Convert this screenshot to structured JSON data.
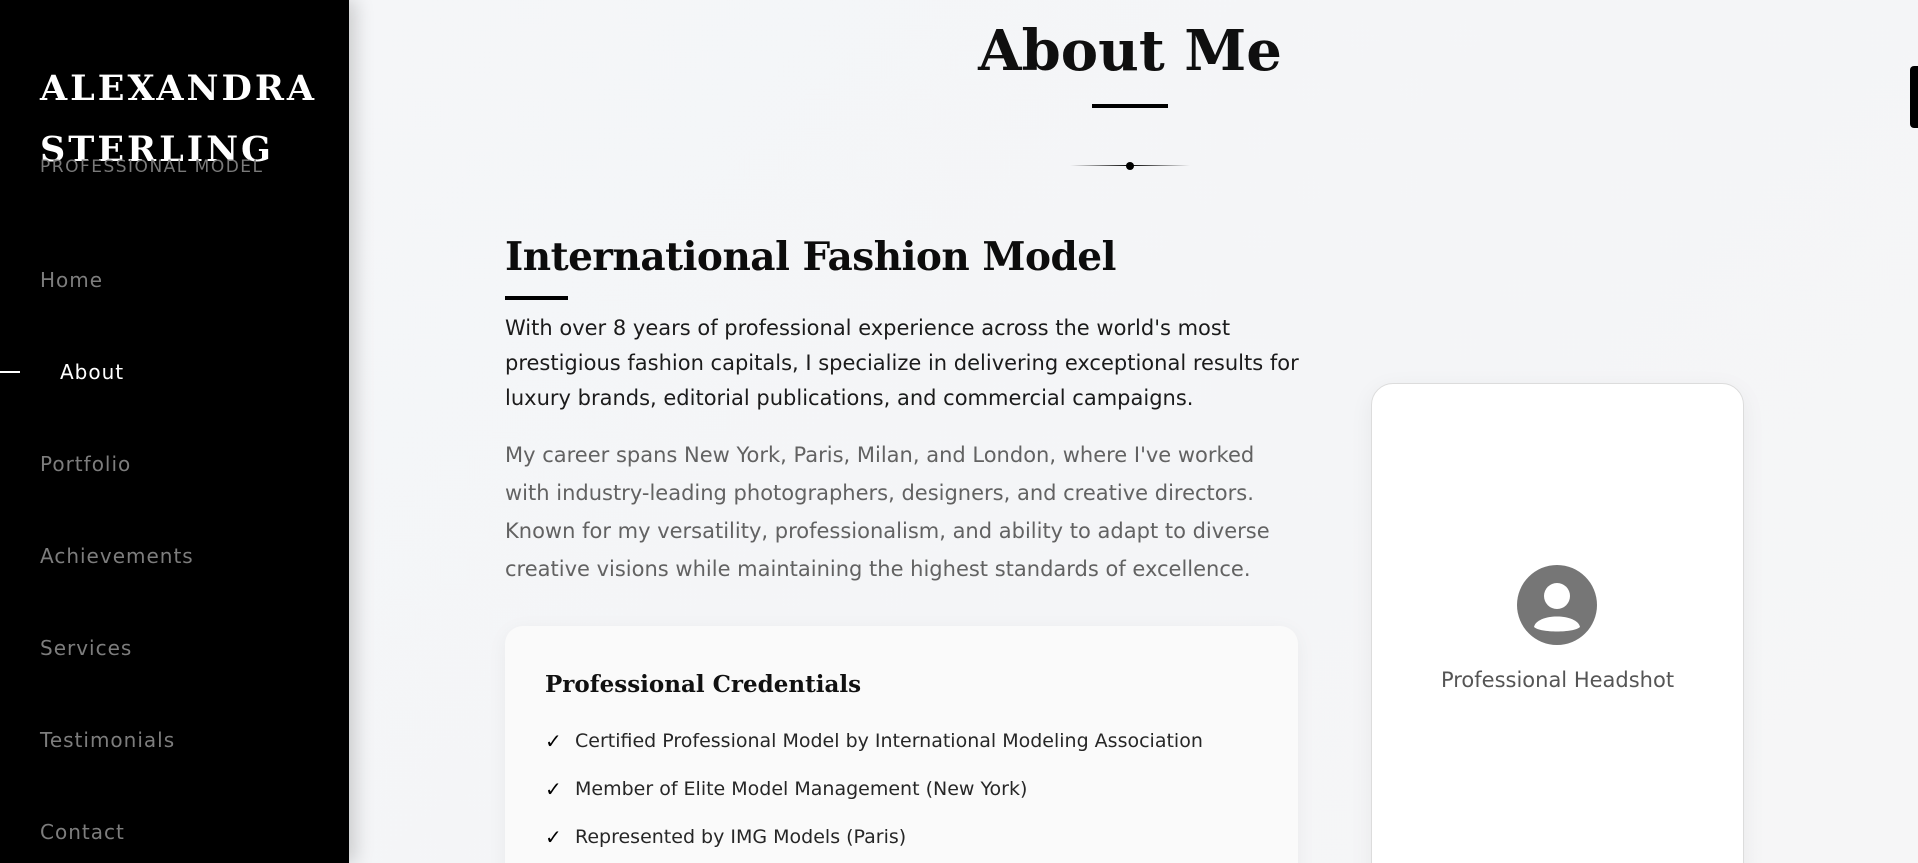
{
  "sidebar": {
    "brand_line1": "ALEXANDRA",
    "brand_line2": "STERLING",
    "brand_subtitle": "PROFESSIONAL MODEL",
    "nav": [
      {
        "label": "Home"
      },
      {
        "label": "About"
      },
      {
        "label": "Portfolio"
      },
      {
        "label": "Achievements"
      },
      {
        "label": "Services"
      },
      {
        "label": "Testimonials"
      },
      {
        "label": "Contact"
      }
    ],
    "active_item": "About"
  },
  "main": {
    "page_title": "About Me",
    "section_heading": "International Fashion Model",
    "lead_paragraph": "With over 8 years of professional experience across the world's most prestigious fashion capitals, I specialize in delivering exceptional results for luxury brands, editorial publications, and commercial campaigns.",
    "body_paragraph": "My career spans New York, Paris, Milan, and London, where I've worked with industry-leading photographers, designers, and creative directors. Known for my versatility, professionalism, and ability to adapt to diverse creative visions while maintaining the highest standards of excellence.",
    "credentials": {
      "title": "Professional Credentials",
      "check_symbol": "✓",
      "items": [
        "Certified Professional Model by International Modeling Association",
        "Member of Elite Model Management (New York)",
        "Represented by IMG Models (Paris)"
      ]
    },
    "photo_card": {
      "label": "Professional Headshot",
      "icon": "user-avatar-icon"
    }
  },
  "colors": {
    "sidebar_bg": "#000000",
    "accent": "#000000",
    "nav_inactive": "#7d7d7d",
    "nav_active": "#ffffff",
    "page_bg": "#f5f6f8"
  }
}
